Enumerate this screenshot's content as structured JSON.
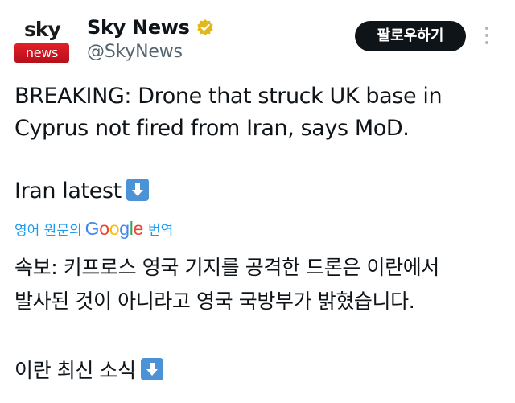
{
  "account": {
    "avatar_top": "sky",
    "avatar_bottom": "news",
    "display_name": "Sky News",
    "handle": "@SkyNews",
    "verified_icon": "gold-verified-badge",
    "verified_color": "#e2b719"
  },
  "actions": {
    "follow_label": "팔로우하기",
    "more_icon": "vertical-ellipsis"
  },
  "tweet": {
    "line1": "BREAKING: Drone that struck UK base in",
    "line2": "Cyprus not fired from Iran, says MoD.",
    "line3": "Iran latest",
    "line3_emoji": "down-arrow-emoji"
  },
  "translation": {
    "prefix": "영어 원문의",
    "google_letters": [
      "G",
      "o",
      "o",
      "g",
      "l",
      "e"
    ],
    "suffix": "번역",
    "line1": "속보: 키프로스 영국 기지를 공격한 드론은 이란에서",
    "line2": "발사된 것이 아니라고 영국 국방부가 밝혔습니다.",
    "line3": "이란 최신 소식",
    "line3_emoji": "down-arrow-emoji"
  },
  "colors": {
    "brand_red": "#c8141e",
    "link_blue": "#1d9bf0",
    "button_bg": "#0f1419",
    "handle_gray": "#536471"
  }
}
